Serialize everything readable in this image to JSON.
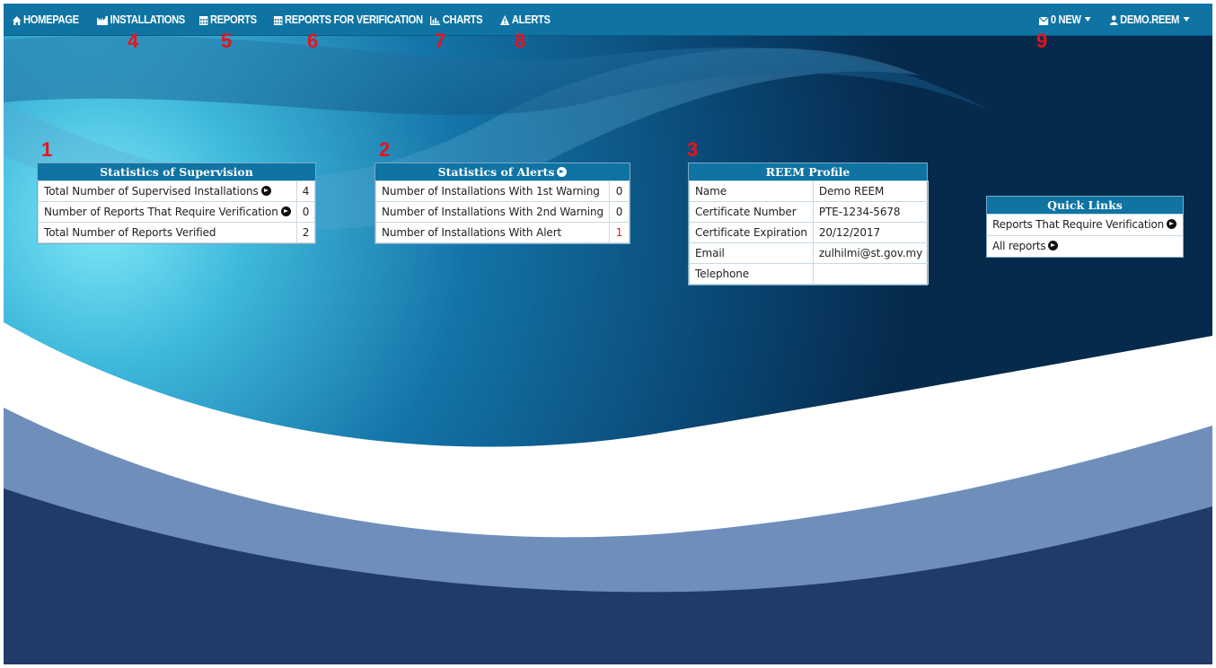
{
  "nav": {
    "homepage": "HOMEPAGE",
    "installations": "INSTALLATIONS",
    "reports": "REPORTS",
    "reports_for_verification": "REPORTS FOR VERIFICATION",
    "charts": "CHARTS",
    "alerts": "ALERTS",
    "messages": "0 NEW",
    "user": "DEMO.REEM",
    "icons": {
      "homepage": "home-icon",
      "installations": "factory-icon",
      "reports": "calendar-icon",
      "reports_for_verification": "calendar-icon",
      "charts": "bar-chart-icon",
      "alerts": "warning-icon",
      "messages": "envelope-icon",
      "user": "user-icon"
    }
  },
  "annotations": {
    "n1": "1",
    "n2": "2",
    "n3": "3",
    "n4": "4",
    "n5": "5",
    "n6": "6",
    "n7": "7",
    "n8": "8",
    "n9": "9"
  },
  "supervision": {
    "title": "Statistics of Supervision",
    "rows": [
      {
        "label": "Total Number of Supervised Installations",
        "value": "4"
      },
      {
        "label": "Number of Reports That Require Verification",
        "value": "0"
      },
      {
        "label": "Total Number of Reports Verified",
        "value": "2"
      }
    ]
  },
  "alerts_stats": {
    "title": "Statistics of Alerts",
    "rows": [
      {
        "label": "Number of Installations With 1st Warning",
        "value": "0"
      },
      {
        "label": "Number of Installations With 2nd Warning",
        "value": "0"
      },
      {
        "label": "Number of Installations With Alert",
        "value": "1"
      }
    ]
  },
  "profile": {
    "title": "REEM Profile",
    "rows": [
      {
        "label": "Name",
        "value": "Demo REEM"
      },
      {
        "label": "Certificate Number",
        "value": "PTE-1234-5678"
      },
      {
        "label": "Certificate Expiration",
        "value": "20/12/2017"
      },
      {
        "label": "Email",
        "value": "zulhilmi@st.gov.my"
      },
      {
        "label": "Telephone",
        "value": ""
      }
    ]
  },
  "quick_links": {
    "title": "Quick Links",
    "items": [
      "Reports That Require Verification",
      "All reports"
    ]
  },
  "colors": {
    "navbar": "#0f74a3",
    "annotation": "#e8131b",
    "alert_value": "#e8131b"
  }
}
